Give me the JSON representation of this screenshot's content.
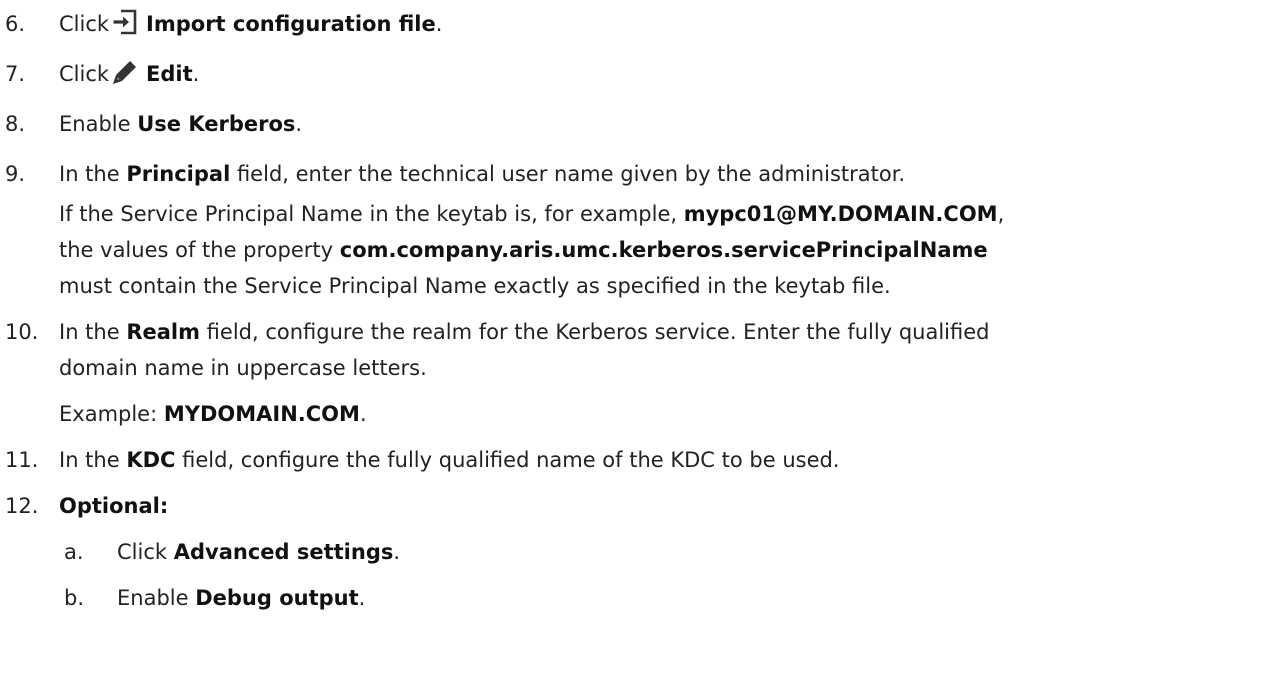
{
  "steps": [
    {
      "num": "6.",
      "pre": "Click",
      "icon": "import-icon",
      "bold": "Import configuration file",
      "post": "."
    },
    {
      "num": "7.",
      "pre": "Click",
      "icon": "pencil-icon",
      "bold": "Edit",
      "post": "."
    },
    {
      "num": "8.",
      "pre": "Enable ",
      "bold": "Use Kerberos",
      "post": "."
    },
    {
      "num": "9.",
      "pre": "In the ",
      "bold": "Principal",
      "post": " field, enter the technical user name given by the administrator.",
      "note": {
        "t1": "If the Service Principal Name in the keytab is, for example, ",
        "b1": "mypc01@MY.DOMAIN.COM",
        "t2": ",",
        "t3": "the values of the property ",
        "b2": "com.company.aris.umc.kerberos.servicePrincipalName",
        "t4": "must contain the Service Principal Name exactly as specified in the keytab file."
      }
    },
    {
      "num": "10.",
      "pre": "In the ",
      "bold": "Realm",
      "post": " field, configure the realm for the Kerberos service. Enter the fully qualified",
      "line2": "domain name in uppercase letters.",
      "example_label": "Example: ",
      "example_value": "MYDOMAIN.COM",
      "example_post": "."
    },
    {
      "num": "11.",
      "pre": "In the ",
      "bold": "KDC",
      "post": " field, configure the fully qualified name of the KDC to be used."
    },
    {
      "num": "12.",
      "bold": "Optional:",
      "substeps": [
        {
          "num": "a.",
          "pre": "Click ",
          "bold": "Advanced settings",
          "post": "."
        },
        {
          "num": "b.",
          "pre": "Enable ",
          "bold": "Debug output",
          "post": "."
        }
      ]
    }
  ]
}
